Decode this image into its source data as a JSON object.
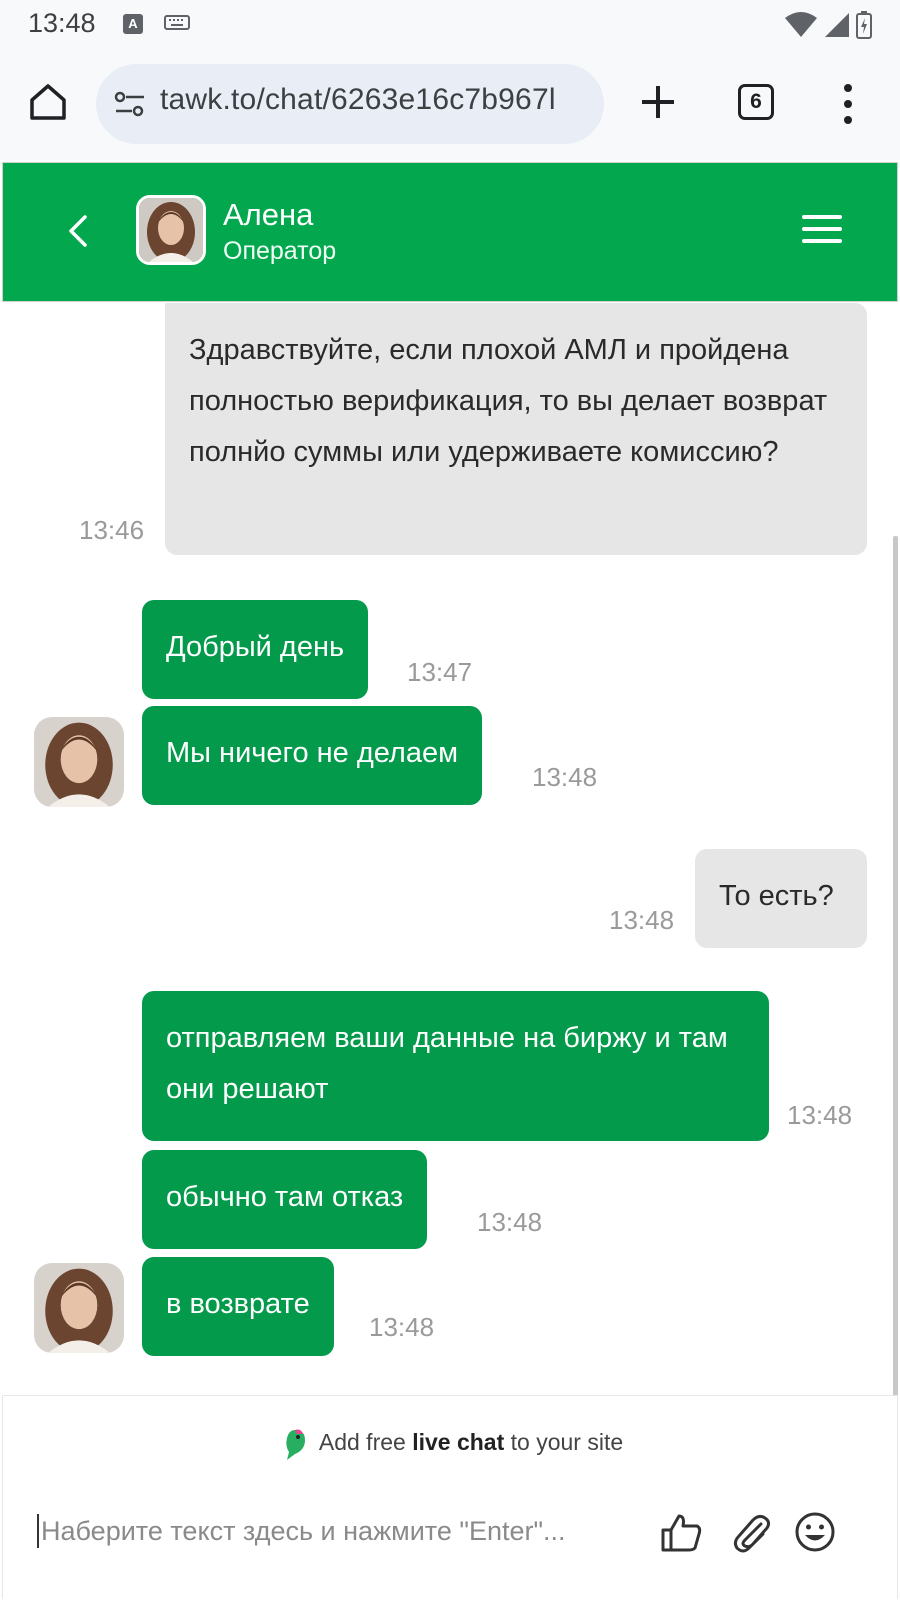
{
  "status_bar": {
    "time": "13:48",
    "keyboard_indicator": "A"
  },
  "browser": {
    "url": "tawk.to/chat/6263e16c7b967l",
    "tab_count": "6"
  },
  "chat_header": {
    "agent_name": "Алена",
    "agent_role": "Оператор"
  },
  "messages": [
    {
      "sender": "visitor",
      "text": "Здравствуйте, если плохой АМЛ и пройдена полностью верификация, то вы делает возврат полнйо суммы или удерживаете комиссию?",
      "time": "13:46"
    },
    {
      "sender": "agent",
      "text": "Добрый день",
      "time": "13:47"
    },
    {
      "sender": "agent",
      "text": "Мы ничего не делаем",
      "time": "13:48"
    },
    {
      "sender": "visitor",
      "text": "То есть?",
      "time": "13:48"
    },
    {
      "sender": "agent",
      "text": "отправляем ваши данные на биржу и там они решают",
      "time": "13:48"
    },
    {
      "sender": "agent",
      "text": "обычно там отказ",
      "time": "13:48"
    },
    {
      "sender": "agent",
      "text": "в возврате",
      "time": "13:48"
    }
  ],
  "footer": {
    "branding_prefix": "Add free",
    "branding_bold": "live chat",
    "branding_suffix": "to your site",
    "input_placeholder": "Наберите текст здесь и нажмите \"Enter\"..."
  },
  "colors": {
    "brand_green": "#03a84e",
    "agent_bubble": "#039a4b",
    "visitor_bubble": "#e6e6e6",
    "timestamp": "#9a9a9a"
  },
  "icons": [
    "home-icon",
    "site-settings-icon",
    "plus-icon",
    "tabs-icon",
    "more-vert-icon",
    "back-icon",
    "hamburger-icon",
    "parrot-logo-icon",
    "thumbs-up-icon",
    "paperclip-icon",
    "emoji-icon"
  ]
}
